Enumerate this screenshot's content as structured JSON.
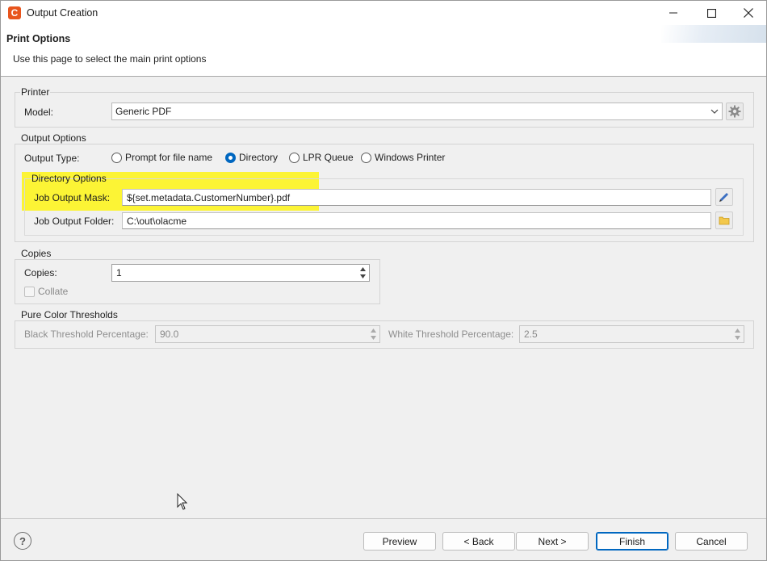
{
  "window": {
    "title": "Output Creation",
    "app_icon_letter": "C"
  },
  "banner": {
    "title": "Print Options",
    "description": "Use this page to select the main print options"
  },
  "printer": {
    "group_label": "Printer",
    "model_label": "Model:",
    "model_value": "Generic PDF"
  },
  "output_options": {
    "group_label": "Output Options",
    "type_label": "Output Type:",
    "types": [
      {
        "label": "Prompt for file name",
        "checked": false
      },
      {
        "label": "Directory",
        "checked": true
      },
      {
        "label": "LPR Queue",
        "checked": false
      },
      {
        "label": "Windows Printer",
        "checked": false
      }
    ]
  },
  "directory_options": {
    "group_label": "Directory Options",
    "mask_label": "Job Output Mask:",
    "mask_value": "${set.metadata.CustomerNumber}.pdf",
    "folder_label": "Job Output Folder:",
    "folder_value": "C:\\out\\olacme"
  },
  "copies": {
    "group_label": "Copies",
    "copies_label": "Copies:",
    "copies_value": "1",
    "collate_label": "Collate",
    "collate_checked": false
  },
  "thresholds": {
    "group_label": "Pure Color Thresholds",
    "black_label": "Black Threshold Percentage:",
    "black_value": "90.0",
    "white_label": "White Threshold Percentage:",
    "white_value": "2.5"
  },
  "footer": {
    "help_label": "?",
    "preview_label": "Preview",
    "back_label": "< Back",
    "next_label": "Next >",
    "finish_label": "Finish",
    "cancel_label": "Cancel"
  },
  "colors": {
    "accent": "#0067c0",
    "highlight": "#fff500",
    "app_icon": "#e8551d"
  }
}
